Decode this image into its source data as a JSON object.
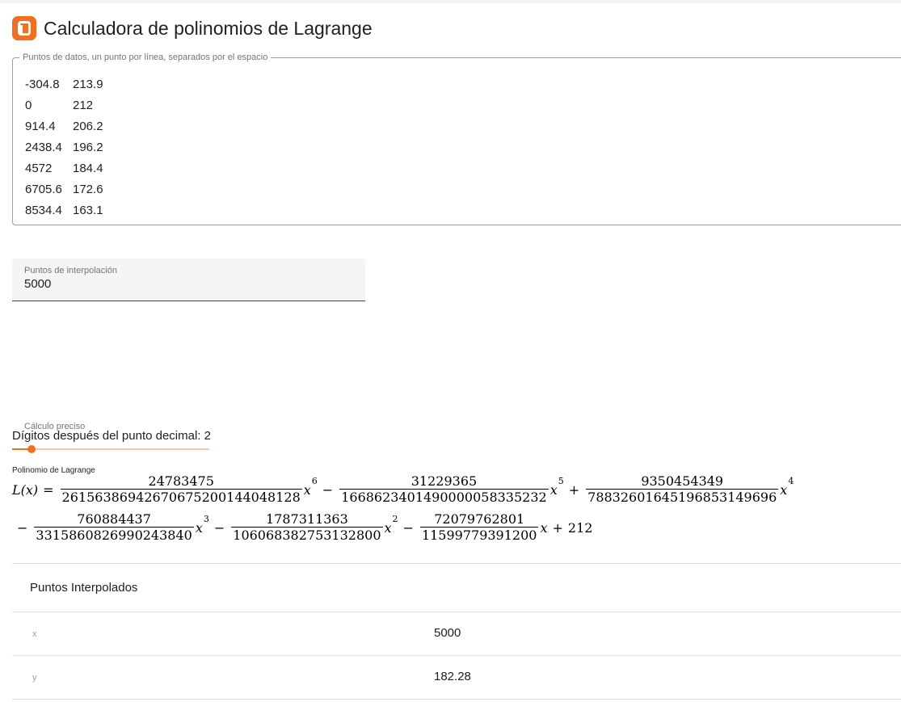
{
  "app": {
    "title": "Calculadora de polinomios de Lagrange",
    "accent_color": "#f26f21",
    "logo_icon": "planetcalc-logo-icon"
  },
  "data_points": {
    "legend": "Puntos de datos, un punto por línea, separados por el espacio",
    "rows": [
      {
        "x": "-304.8",
        "y": "213.9"
      },
      {
        "x": "0",
        "y": "212"
      },
      {
        "x": "914.4",
        "y": "206.2"
      },
      {
        "x": "2438.4",
        "y": "196.2"
      },
      {
        "x": "4572",
        "y": "184.4"
      },
      {
        "x": "6705.6",
        "y": "172.6"
      },
      {
        "x": "8534.4",
        "y": "163.1"
      }
    ]
  },
  "interpolation": {
    "label": "Puntos de interpolación",
    "value": "5000"
  },
  "precision": {
    "precise_label": "Cálculo preciso",
    "digits_label": "Dígitos después del punto decimal: 2",
    "slider_fraction": 0.1
  },
  "polynomial": {
    "label": "Polinomio de Lagrange",
    "lhs": "L(x)",
    "terms": [
      {
        "sign": "",
        "num": "24783475",
        "den": "2615638694267067520014404812​8",
        "power": "6"
      },
      {
        "sign": "−",
        "num": "31229365",
        "den": "1668623401490000058335232",
        "power": "5"
      },
      {
        "sign": "+",
        "num": "9350454349",
        "den": "788326016451968531496​96",
        "power": "4"
      },
      {
        "sign": "−",
        "num": "760884437",
        "den": "3315860826990243840",
        "power": "3"
      },
      {
        "sign": "−",
        "num": "1787311363",
        "den": "106068382753132800",
        "power": "2"
      },
      {
        "sign": "−",
        "num": "72079762801",
        "den": "11599779391200",
        "power": ""
      }
    ],
    "constant_sign": "+",
    "constant": "212"
  },
  "results": {
    "title": "Puntos Interpolados",
    "rows": [
      {
        "key": "x",
        "value": "5000"
      },
      {
        "key": "y",
        "value": "182.28"
      }
    ]
  }
}
